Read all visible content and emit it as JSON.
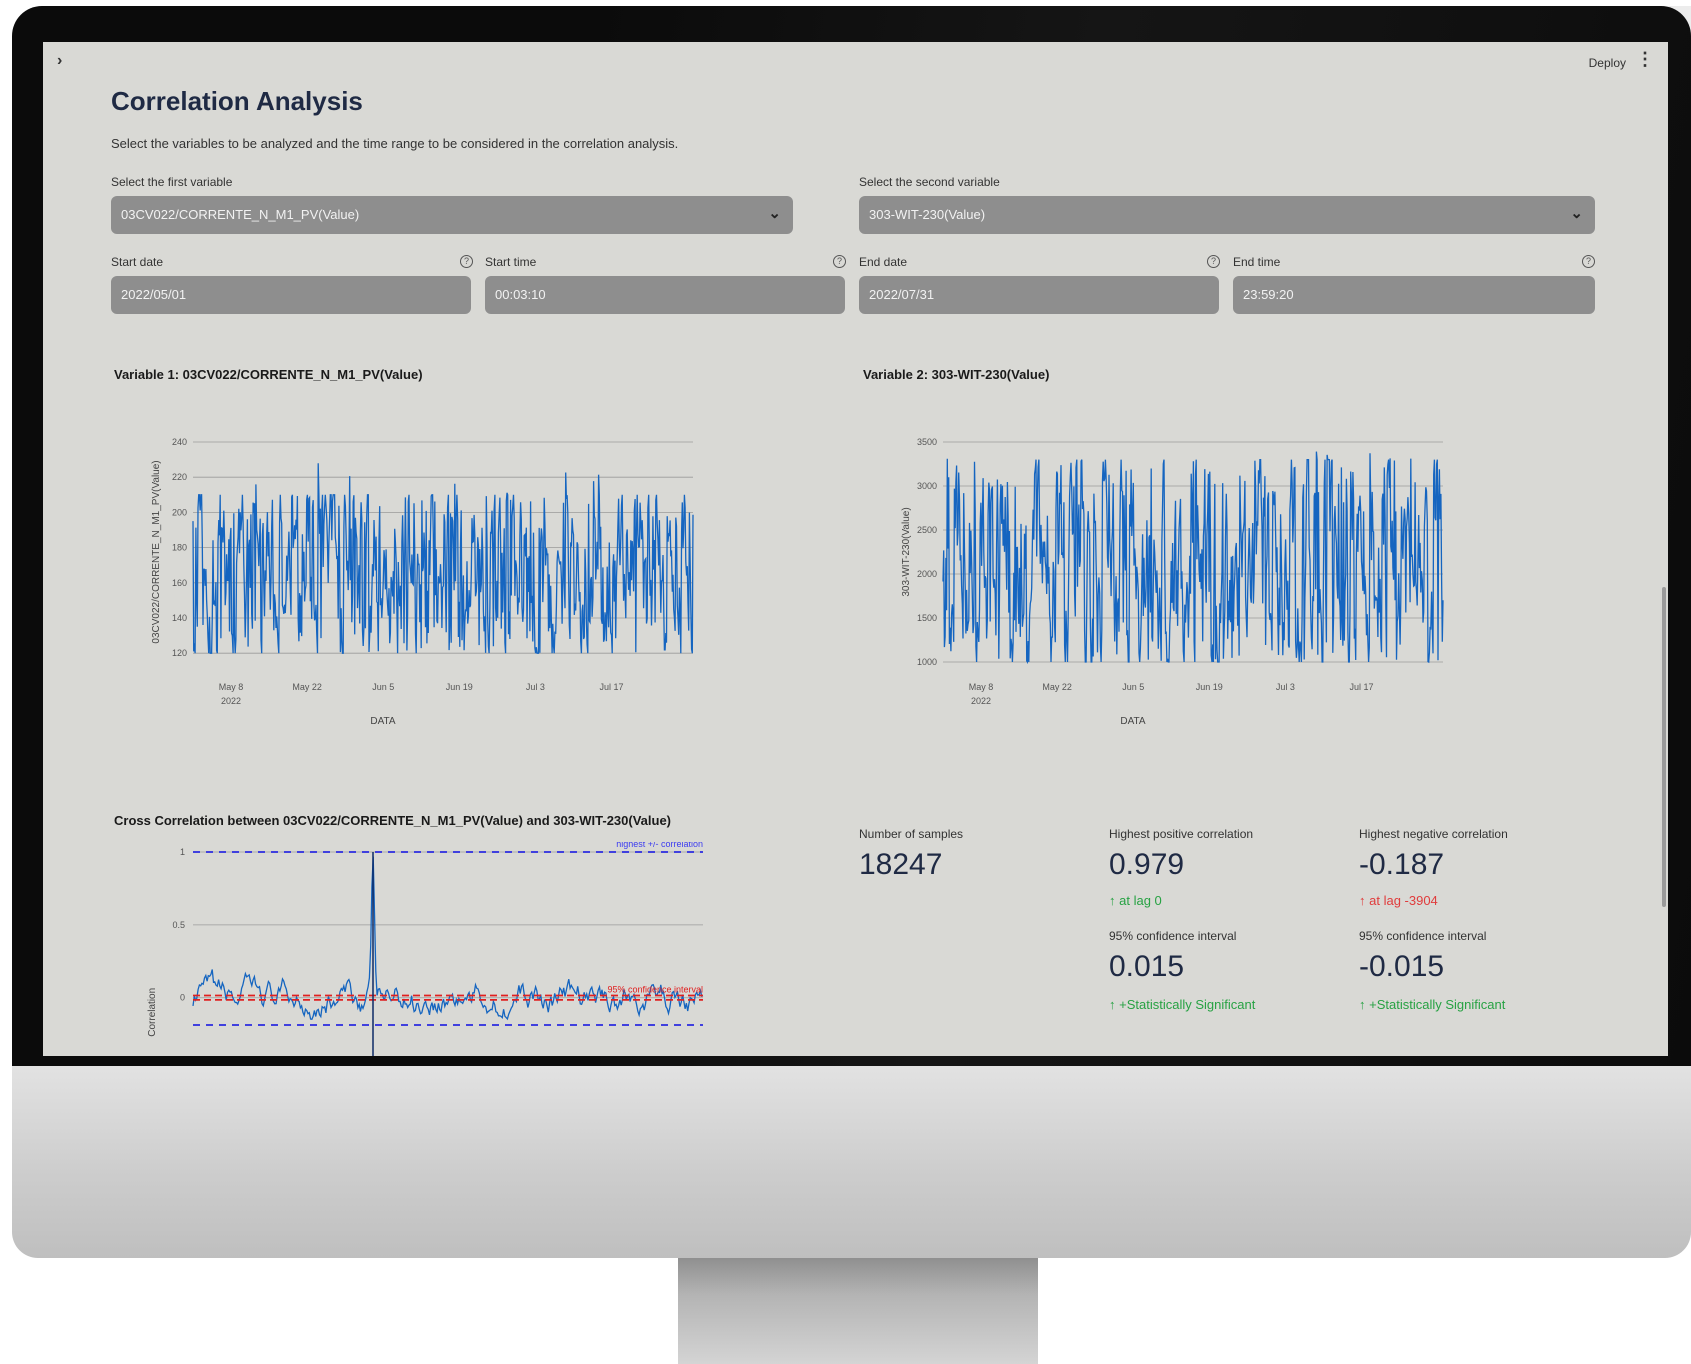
{
  "topbar": {
    "expand": "›",
    "deploy": "Deploy",
    "menu": "⋮"
  },
  "page": {
    "title": "Correlation Analysis",
    "subtitle": "Select the variables to be analyzed and the time range to be considered in the correlation analysis."
  },
  "var1": {
    "label": "Select the first variable",
    "value": "03CV022/CORRENTE_N_M1_PV(Value)"
  },
  "var2": {
    "label": "Select the second variable",
    "value": "303-WIT-230(Value)"
  },
  "start_date": {
    "label": "Start date",
    "value": "2022/05/01"
  },
  "start_time": {
    "label": "Start time",
    "value": "00:03:10"
  },
  "end_date": {
    "label": "End date",
    "value": "2022/07/31"
  },
  "end_time": {
    "label": "End time",
    "value": "23:59:20"
  },
  "chart1": {
    "title": "Variable 1: 03CV022/CORRENTE_N_M1_PV(Value)"
  },
  "chart2": {
    "title": "Variable 2: 303-WIT-230(Value)"
  },
  "chart3": {
    "title": "Cross Correlation between 03CV022/CORRENTE_N_M1_PV(Value) and 303-WIT-230(Value)"
  },
  "chart_data": [
    {
      "type": "line",
      "title": "",
      "xlabel": "DATA",
      "ylabel": "03CV022/CORRENTE_N_M1_PV(Value)",
      "x_ticks": [
        "May 8",
        "May 22",
        "Jun 5",
        "Jun 19",
        "Jul 3",
        "Jul 17"
      ],
      "x_tick_sub": "2022",
      "x_range": [
        "2022-05-01",
        "2022-07-31"
      ],
      "y_ticks": [
        120,
        140,
        160,
        180,
        200,
        220,
        240
      ],
      "ylim": [
        115,
        240
      ],
      "typical_range": [
        120,
        210
      ],
      "peak_max": 235,
      "color": "#1565c0",
      "grid": true
    },
    {
      "type": "line",
      "title": "",
      "xlabel": "DATA",
      "ylabel": "303-WIT-230(Value)",
      "x_ticks": [
        "May 8",
        "May 22",
        "Jun 5",
        "Jun 19",
        "Jul 3",
        "Jul 17"
      ],
      "x_tick_sub": "2022",
      "x_range": [
        "2022-05-01",
        "2022-07-31"
      ],
      "y_ticks": [
        1000,
        1500,
        2000,
        2500,
        3000,
        3500
      ],
      "ylim": [
        1000,
        3500
      ],
      "typical_range": [
        1000,
        3300
      ],
      "peak_max": 3400,
      "color": "#1565c0",
      "grid": true
    },
    {
      "type": "line",
      "title": "",
      "ylabel": "Correlation",
      "y_ticks": [
        0,
        0.5,
        1
      ],
      "ylim": [
        -0.4,
        1.0
      ],
      "peak": {
        "lag": 0,
        "value": 0.979
      },
      "annotations": [
        "highest +/- correlation",
        "95% confidence interval"
      ],
      "reference_lines": {
        "highest": [
          1,
          -0.187
        ],
        "confidence": [
          0.015,
          -0.015
        ]
      },
      "color": "#1565c0"
    }
  ],
  "metrics": {
    "samples": {
      "label": "Number of samples",
      "value": "18247"
    },
    "pos": {
      "label": "Highest positive correlation",
      "value": "0.979",
      "delta": "at lag 0",
      "arrow": "↑"
    },
    "neg": {
      "label": "Highest negative correlation",
      "value": "-0.187",
      "delta": "at lag -3904",
      "arrow": "↑"
    },
    "ci_pos": {
      "label": "95% confidence interval",
      "value": "0.015",
      "delta": "+Statistically Significant",
      "arrow": "↑"
    },
    "ci_neg": {
      "label": "95% confidence interval",
      "value": "-0.015",
      "delta": "+Statistically Significant",
      "arrow": "↑"
    }
  }
}
